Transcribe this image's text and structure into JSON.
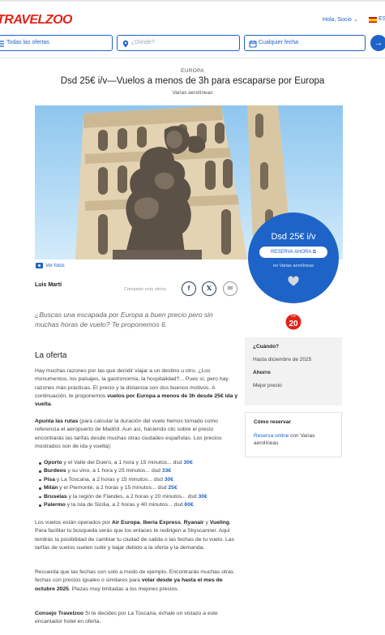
{
  "header": {
    "logo": "TRAVELZOO",
    "greeting": "Hola, Socio",
    "greeting_icon": "chevron-down-icon",
    "lang": "ES"
  },
  "search": {
    "offers_label": "Todas las ofertas",
    "where_placeholder": "¿Dónde?",
    "date_label": "Cualquier fecha",
    "submit_icon": "arrow-right-icon"
  },
  "deal": {
    "region": "EUROPA",
    "title": "Dsd 25€ i/v—Vuelos a menos de 3h para escaparse por Europa",
    "airlines": "Varias aerolíneas",
    "see_photos": "Ver fotos",
    "price": "Dsd 25€ i/v",
    "book_button": "RESERVA AHORA",
    "book_sub": "en Varias aerolíneas",
    "author": "Luis Martí",
    "share_label": "Comparte esta oferta",
    "intro": "¿Buscas una escapada por Europa a buen precio pero sin muchas horas de vuelo? Te proponemos 6.",
    "badge_top": "TOP",
    "badge_num": "20"
  },
  "sidebar": {
    "when_heading": "¿Cuándo?",
    "when_value": "Hasta diciembre de 2025",
    "save_heading": "Ahorro",
    "save_value": "Mejor precio",
    "book_heading": "Cómo reservar",
    "book_link": "Reserva online",
    "book_rest": " con Varias aerolíneas"
  },
  "article": {
    "heading": "La oferta",
    "p1_text": "Hay muchas razones por las que decidir viajar a un destino u otro. ¿Los monumentos, los paisajes, la gastronomía, la hospitalidad?... Pues sí, pero hay razones más prácticas. El precio y la distancia son dos buenos motivos. A continuación, te proponemos ",
    "p1_bold": "vuelos por Europa a menos de 3h desde 25€ ida y vuelta",
    "p1_end": ".",
    "p2_bold": "Apunta las rutas",
    "p2_text": " (para calcular la duración del vuelo hemos tomado como referencia el aeropuerto de Madrid. Aun así, haciendo clic sobre el precio encontrarás las tarifas desde muchas otras ciudades españolas. Los precios mostrados son de ida y vuelta):",
    "routes": [
      {
        "city": "Oporto",
        "rest": " y el Valle del Duero, a 1 hora y 15 minutos... dsd ",
        "price": "30€"
      },
      {
        "city": "Burdeos",
        "rest": " y su vino, a 1 hora y 25 minutos... dsd ",
        "price": "33€"
      },
      {
        "city": "Pisa",
        "rest": " y La Toscana, a 2 horas y 15 minutos... dsd ",
        "price": "30€"
      },
      {
        "city": "Milán",
        "rest": " y el Piemonte, a 2 horas y 15 minutos... dsd ",
        "price": "25€"
      },
      {
        "city": "Bruselas",
        "rest": " y la región de Flandes, a 2 horas y 20 minutos... dsd ",
        "price": "30€"
      },
      {
        "city": "Palermo",
        "rest": " y la isla de Sicilia, a 2 horas y 40 minutos... dsd ",
        "price": "60€"
      }
    ],
    "p3_a": "Los vuelos están operados por ",
    "p3_b1": "Air Europa",
    "p3_c": ", ",
    "p3_b2": "Iberia Express",
    "p3_d": ", ",
    "p3_b3": "Ryanair",
    "p3_e": " y ",
    "p3_b4": "Vueling",
    "p3_f": ". Para facilitar tu búsqueda verás que los enlaces te redirigen a Skyscanner. Aquí tendrás la posibilidad de cambiar tu ciudad de salida o las fechas de tu vuelo. Las tarifas de vuelos suelen subir y bajar debido a la oferta y la demanda.",
    "p4_text": "Recuerda que las fechas son solo a modo de ejemplo. Encontrarás muchas otras fechas con precios iguales o similares para ",
    "p4_bold": "volar desde ya hasta el mes de octubre 2025",
    "p4_end": ". Plazas muy limitadas a los mejores precios.",
    "p5_bold": "Consejo Travelzoo",
    "p5_text": " Si te decides por La Toscana, échale un vistazo a este encantador hotel en oferta."
  },
  "colors": {
    "brand_red": "#e2231a",
    "accent_blue": "#1e64c8"
  }
}
